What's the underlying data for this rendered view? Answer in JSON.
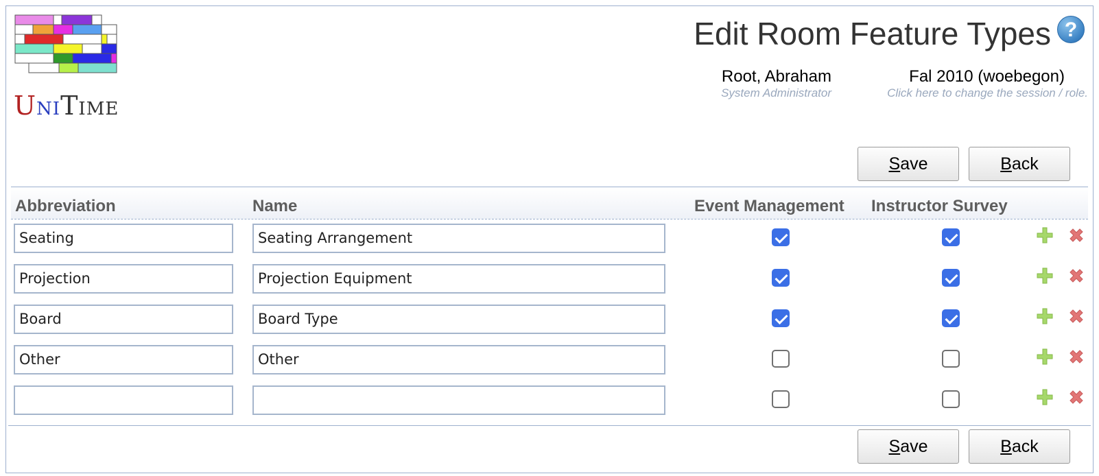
{
  "logo": {
    "letters": [
      "U",
      "NI",
      "T",
      "IME"
    ],
    "block_colors": [
      "#e98be8",
      "#8c35d9",
      "#f0a23a",
      "#e62ee3",
      "#5aa0f0",
      "#e02a2a",
      "#7be8c8",
      "#f4f42a",
      "#2a2ae6",
      "#2f9a2a",
      "#b7f04a",
      "#7ee0cf"
    ]
  },
  "header": {
    "title": "Edit Room Feature Types",
    "help_symbol": "?",
    "user_name": "Root, Abraham",
    "user_role": "System Administrator",
    "session": "Fal 2010 (woebegon)",
    "session_hint": "Click here to change the session / role."
  },
  "buttons": {
    "save_prefix": "S",
    "save_rest": "ave",
    "back_prefix": "B",
    "back_rest": "ack"
  },
  "table": {
    "columns": [
      "Abbreviation",
      "Name",
      "Event Management",
      "Instructor Survey"
    ],
    "rows": [
      {
        "abbreviation": "Seating",
        "name": "Seating Arrangement",
        "event_management": true,
        "instructor_survey": true
      },
      {
        "abbreviation": "Projection",
        "name": "Projection Equipment",
        "event_management": true,
        "instructor_survey": true
      },
      {
        "abbreviation": "Board",
        "name": "Board Type",
        "event_management": true,
        "instructor_survey": true
      },
      {
        "abbreviation": "Other",
        "name": "Other",
        "event_management": false,
        "instructor_survey": false
      },
      {
        "abbreviation": "",
        "name": "",
        "event_management": false,
        "instructor_survey": false
      }
    ]
  },
  "colors": {
    "accent": "#3b6fe6",
    "border": "#9cb0ce",
    "add_icon": "#a6d86a",
    "delete_icon": "#e27676"
  },
  "icons": [
    "unitime-logo",
    "help-icon",
    "add-row-icon",
    "delete-row-icon",
    "checkbox"
  ]
}
